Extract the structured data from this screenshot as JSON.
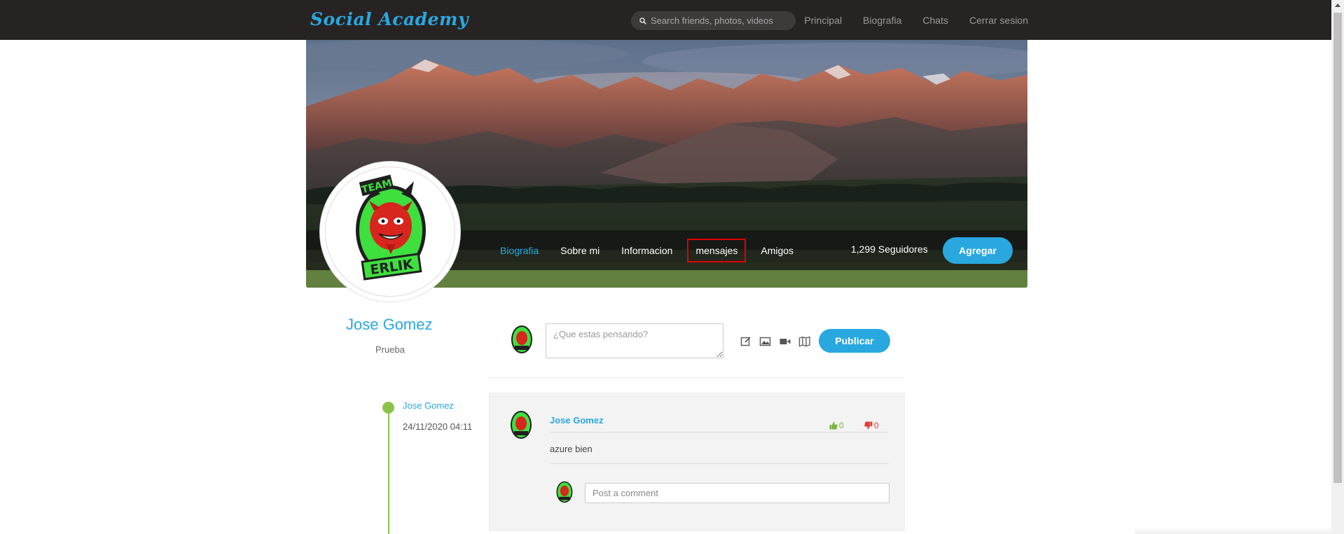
{
  "navbar": {
    "brand": "Social Academy",
    "search_placeholder": "Search friends, photos, videos",
    "links": [
      "Principal",
      "Biografia",
      "Chats",
      "Cerrar sesion"
    ]
  },
  "profile_bar": {
    "tabs": [
      "Biografia",
      "Sobre mi",
      "Informacion",
      "mensajes",
      "Amigos"
    ],
    "active_tab": "Biografia",
    "highlighted_tab": "mensajes",
    "followers": "1,299 Seguidores",
    "add_button": "Agregar"
  },
  "avatar": {
    "logo_text_top": "TEAM",
    "logo_text_bottom": "ERLIK"
  },
  "profile": {
    "name": "Jose Gomez",
    "subtitle": "Prueba"
  },
  "composer": {
    "placeholder": "¿Que estas pensando?",
    "publish_button": "Publicar",
    "tool_icons": [
      "edit-icon",
      "image-icon",
      "video-icon",
      "map-icon"
    ]
  },
  "timeline": [
    {
      "author": "Jose Gomez",
      "date": "24/11/2020 04:11",
      "post": {
        "author": "Jose Gomez",
        "likes": "0",
        "dislikes": "0",
        "text": "azure bien",
        "comment_placeholder": "Post a comment"
      }
    }
  ],
  "colors": {
    "accent": "#29a8e0",
    "navbar_bg": "#272323",
    "timeline_green": "#8bc34a",
    "like_green": "#7cb342",
    "dislike_red": "#e53935",
    "highlight_red": "#e00000"
  }
}
